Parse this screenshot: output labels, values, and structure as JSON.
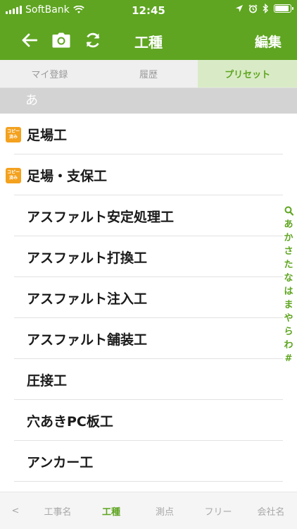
{
  "status_bar": {
    "carrier": "SoftBank",
    "time": "12:45",
    "battery_level": 0.9
  },
  "nav": {
    "title": "工種",
    "edit_label": "編集",
    "icons": [
      "back-arrow-icon",
      "camera-icon",
      "refresh-icon"
    ]
  },
  "tabs": [
    {
      "label": "マイ登録",
      "active": false
    },
    {
      "label": "履歴",
      "active": false
    },
    {
      "label": "プリセット",
      "active": true
    }
  ],
  "section": {
    "header": "あ"
  },
  "badge_text": {
    "line1": "コピー",
    "line2": "済み"
  },
  "items": [
    {
      "label": "足場工",
      "copied": true
    },
    {
      "label": "足場・支保工",
      "copied": true
    },
    {
      "label": "アスファルト安定処理工",
      "copied": false
    },
    {
      "label": "アスファルト打換工",
      "copied": false
    },
    {
      "label": "アスファルト注入工",
      "copied": false
    },
    {
      "label": "アスファルト舗装工",
      "copied": false
    },
    {
      "label": "圧接工",
      "copied": false
    },
    {
      "label": "穴あきPC板工",
      "copied": false
    },
    {
      "label": "アンカー工",
      "copied": false
    }
  ],
  "index": [
    "あ",
    "か",
    "さ",
    "た",
    "な",
    "は",
    "ま",
    "や",
    "ら",
    "わ",
    "#"
  ],
  "bottom_tabs": [
    {
      "label": "<",
      "active": false
    },
    {
      "label": "工事名",
      "active": false
    },
    {
      "label": "工種",
      "active": true
    },
    {
      "label": "測点",
      "active": false
    },
    {
      "label": "フリー",
      "active": false
    },
    {
      "label": "会社名",
      "active": false
    }
  ],
  "colors": {
    "accent": "#5fa521",
    "badge": "#f3a11e",
    "section_header": "#d3d3d3"
  }
}
